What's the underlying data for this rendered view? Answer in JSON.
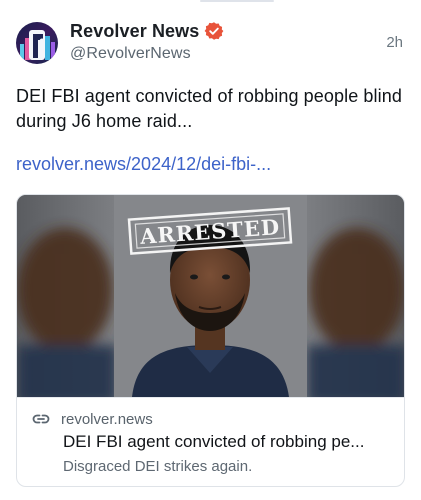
{
  "post": {
    "author": {
      "display_name": "Revolver News",
      "handle": "@RevolverNews",
      "verified": true,
      "avatar_icon": "revolver-news-logo-icon"
    },
    "timestamp": "2h",
    "text": "DEI FBI agent convicted of robbing people blind during J6 home raid...",
    "link": "revolver.news/2024/12/dei-fbi-..."
  },
  "link_card": {
    "image_stamp": "ARRESTED",
    "domain": "revolver.news",
    "title": "DEI FBI agent convicted of robbing pe...",
    "description": "Disgraced DEI strikes again.",
    "link_icon": "link-icon"
  },
  "colors": {
    "verified_badge": "#e8533a",
    "link": "#3d63c9",
    "handle": "#5b6670"
  }
}
